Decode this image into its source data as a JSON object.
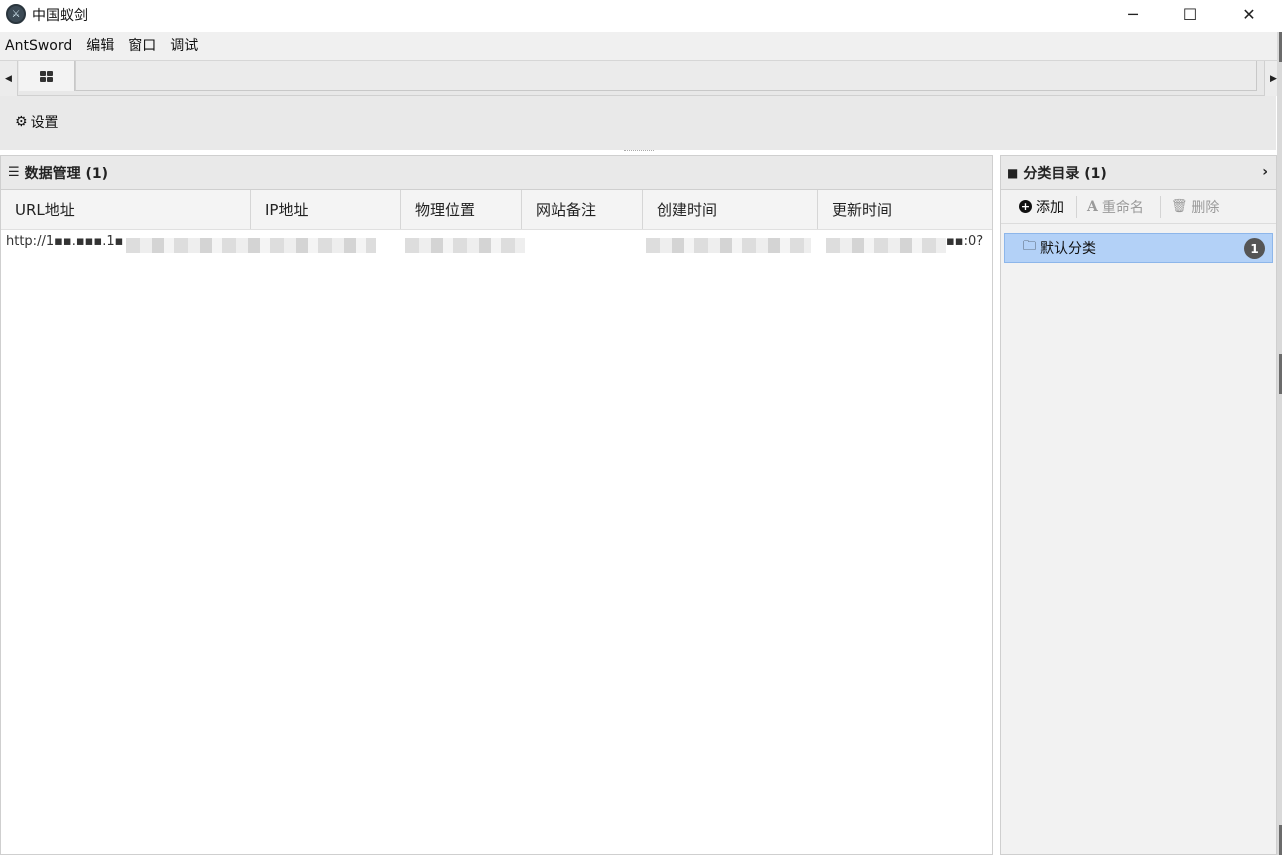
{
  "window": {
    "title": "中国蚁剑",
    "minimize_glyph": "─",
    "maximize_glyph": "☐",
    "close_glyph": "✕"
  },
  "menubar": {
    "items": [
      "AntSword",
      "编辑",
      "窗口",
      "调试"
    ]
  },
  "tabs": {
    "home_icon": "grid-icon",
    "scroll_left_glyph": "◀",
    "scroll_right_glyph": "▶"
  },
  "toolbar": {
    "settings_label": "设置",
    "settings_icon": "gear-icon"
  },
  "data_panel": {
    "title": "数据管理 (1)",
    "columns": [
      "URL地址",
      "IP地址",
      "物理位置",
      "网站备注",
      "创建时间",
      "更新时间"
    ],
    "rows": [
      {
        "url": "http://1▪▪.▪▪▪.1▪",
        "tail": "▪▪:0?"
      }
    ]
  },
  "category_panel": {
    "title": "分类目录 (1)",
    "add_label": "添加",
    "rename_label": "重命名",
    "delete_label": "删除",
    "items": [
      {
        "name": "默认分类",
        "count": "1"
      }
    ]
  }
}
